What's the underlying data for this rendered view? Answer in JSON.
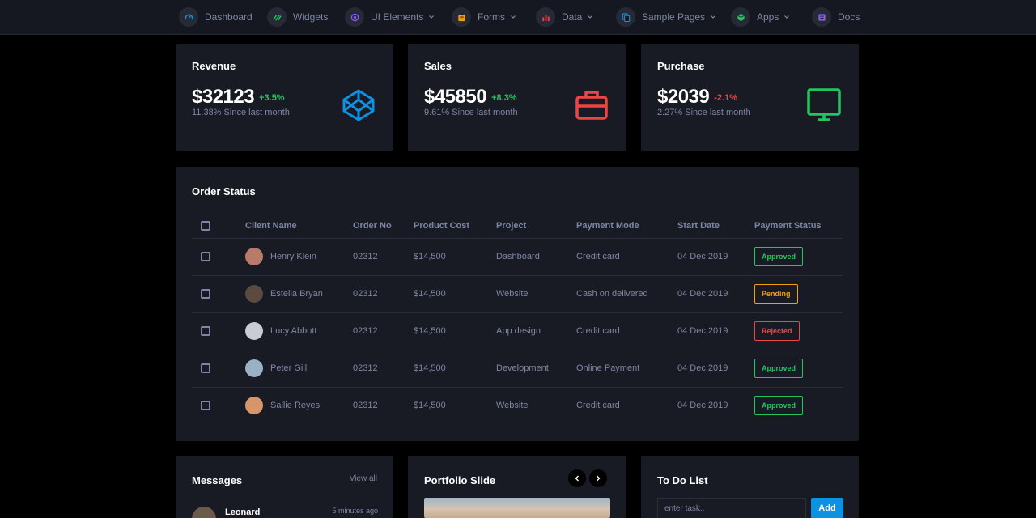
{
  "nav": {
    "items": [
      {
        "label": "Dashboard",
        "icon": "gauge-icon",
        "icon_color": "#0d91e3",
        "dropdown": false
      },
      {
        "label": "Widgets",
        "icon": "widgets-icon",
        "icon_color": "#22c55e",
        "dropdown": false
      },
      {
        "label": "UI Elements",
        "icon": "ui-elements-icon",
        "icon_color": "#8b5cf6",
        "dropdown": true
      },
      {
        "label": "Forms",
        "icon": "forms-icon",
        "icon_color": "#f59e0b",
        "dropdown": true
      },
      {
        "label": "Data",
        "icon": "chart-icon",
        "icon_color": "#ef4444",
        "dropdown": true
      },
      {
        "label": "Sample Pages",
        "icon": "pages-icon",
        "icon_color": "#0d91e3",
        "dropdown": true
      },
      {
        "label": "Apps",
        "icon": "apps-icon",
        "icon_color": "#22c55e",
        "dropdown": true
      },
      {
        "label": "Docs",
        "icon": "docs-icon",
        "icon_color": "#8b5cf6",
        "dropdown": false
      }
    ]
  },
  "stats": [
    {
      "title": "Revenue",
      "value": "$32123",
      "change": "+3.5%",
      "trend": "up",
      "subtitle": "11.38% Since last month",
      "icon": "codepen-icon",
      "icon_color": "#0d91e3"
    },
    {
      "title": "Sales",
      "value": "$45850",
      "change": "+8.3%",
      "trend": "up",
      "subtitle": "9.61% Since last month",
      "icon": "briefcase-icon",
      "icon_color": "#ef4444"
    },
    {
      "title": "Purchase",
      "value": "$2039",
      "change": "-2.1%",
      "trend": "down",
      "subtitle": "2.27% Since last month",
      "icon": "monitor-icon",
      "icon_color": "#22c55e"
    }
  ],
  "colors": {
    "up": "#22c55e",
    "down": "#ef4444"
  },
  "orders": {
    "title": "Order Status",
    "columns": [
      "Client Name",
      "Order No",
      "Product Cost",
      "Project",
      "Payment Mode",
      "Start Date",
      "Payment Status"
    ],
    "rows": [
      {
        "client": "Henry Klein",
        "order_no": "02312",
        "cost": "$14,500",
        "project": "Dashboard",
        "payment_mode": "Credit card",
        "start_date": "04 Dec 2019",
        "status": "Approved",
        "status_type": "approved",
        "avatar_color": "#b87b6a"
      },
      {
        "client": "Estella Bryan",
        "order_no": "02312",
        "cost": "$14,500",
        "project": "Website",
        "payment_mode": "Cash on delivered",
        "start_date": "04 Dec 2019",
        "status": "Pending",
        "status_type": "pending",
        "avatar_color": "#5a4a40"
      },
      {
        "client": "Lucy Abbott",
        "order_no": "02312",
        "cost": "$14,500",
        "project": "App design",
        "payment_mode": "Credit card",
        "start_date": "04 Dec 2019",
        "status": "Rejected",
        "status_type": "rejected",
        "avatar_color": "#c9ccd4"
      },
      {
        "client": "Peter Gill",
        "order_no": "02312",
        "cost": "$14,500",
        "project": "Development",
        "payment_mode": "Online Payment",
        "start_date": "04 Dec 2019",
        "status": "Approved",
        "status_type": "approved",
        "avatar_color": "#9ab0c4"
      },
      {
        "client": "Sallie Reyes",
        "order_no": "02312",
        "cost": "$14,500",
        "project": "Website",
        "payment_mode": "Credit card",
        "start_date": "04 Dec 2019",
        "status": "Approved",
        "status_type": "approved",
        "avatar_color": "#d9956a"
      }
    ]
  },
  "messages": {
    "title": "Messages",
    "view_all": "View all",
    "items": [
      {
        "name": "Leonard",
        "time": "5 minutes ago"
      }
    ]
  },
  "portfolio": {
    "title": "Portfolio Slide"
  },
  "todo": {
    "title": "To Do List",
    "placeholder": "enter task..",
    "add_label": "Add"
  }
}
